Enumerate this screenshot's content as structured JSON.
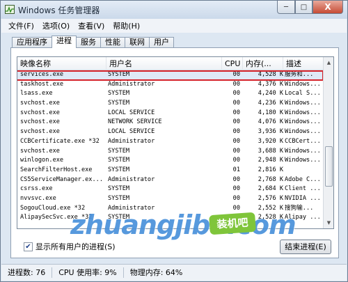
{
  "window": {
    "title": "Windows 任务管理器"
  },
  "window_controls": {
    "minimize": "─",
    "maximize": "□",
    "close": "X"
  },
  "menu": [
    "文件(F)",
    "选项(O)",
    "查看(V)",
    "帮助(H)"
  ],
  "tabs": [
    "应用程序",
    "进程",
    "服务",
    "性能",
    "联网",
    "用户"
  ],
  "active_tab": "进程",
  "columns": [
    "映像名称",
    "用户名",
    "CPU",
    "内存(...",
    "描述"
  ],
  "processes": [
    [
      "services.exe",
      "SYSTEM",
      "00",
      "4,528 K",
      "服务和..."
    ],
    [
      "taskhost.exe",
      "Administrator",
      "00",
      "4,376 K",
      "Windows..."
    ],
    [
      "lsass.exe",
      "SYSTEM",
      "00",
      "4,240 K",
      "Local S..."
    ],
    [
      "svchost.exe",
      "SYSTEM",
      "00",
      "4,236 K",
      "Windows..."
    ],
    [
      "svchost.exe",
      "LOCAL SERVICE",
      "00",
      "4,180 K",
      "Windows..."
    ],
    [
      "svchost.exe",
      "NETWORK SERVICE",
      "00",
      "4,076 K",
      "Windows..."
    ],
    [
      "svchost.exe",
      "LOCAL SERVICE",
      "00",
      "3,936 K",
      "Windows..."
    ],
    [
      "CCBCertificate.exe *32",
      "Administrator",
      "00",
      "3,920 K",
      "CCBCert..."
    ],
    [
      "svchost.exe",
      "SYSTEM",
      "00",
      "3,688 K",
      "Windows..."
    ],
    [
      "winlogon.exe",
      "SYSTEM",
      "00",
      "2,948 K",
      "Windows..."
    ],
    [
      "SearchFilterHost.exe",
      "SYSTEM",
      "01",
      "2,816 K",
      ""
    ],
    [
      "CS5ServiceManager.ex...",
      "Administrator",
      "00",
      "2,768 K",
      "Adobe C..."
    ],
    [
      "csrss.exe",
      "SYSTEM",
      "00",
      "2,684 K",
      "Client ..."
    ],
    [
      "nvvsvc.exe",
      "SYSTEM",
      "00",
      "2,576 K",
      "NVIDIA ..."
    ],
    [
      "SogouCloud.exe *32",
      "Administrator",
      "00",
      "2,552 K",
      "搜狗输..."
    ],
    [
      "AlipaySecSvc.exe *32",
      "SYSTEM",
      "00",
      "2,528 K",
      "Alipay ..."
    ]
  ],
  "selected_row": 0,
  "show_all_users": {
    "label": "显示所有用户的进程(S)",
    "checked": true
  },
  "end_process_label": "结束进程(E)",
  "status": {
    "processes": "进程数: 76",
    "cpu": "CPU 使用率: 9%",
    "memory": "物理内存: 64%"
  },
  "watermark": {
    "text": "zhuangjiba.com",
    "badge": "装机吧"
  }
}
